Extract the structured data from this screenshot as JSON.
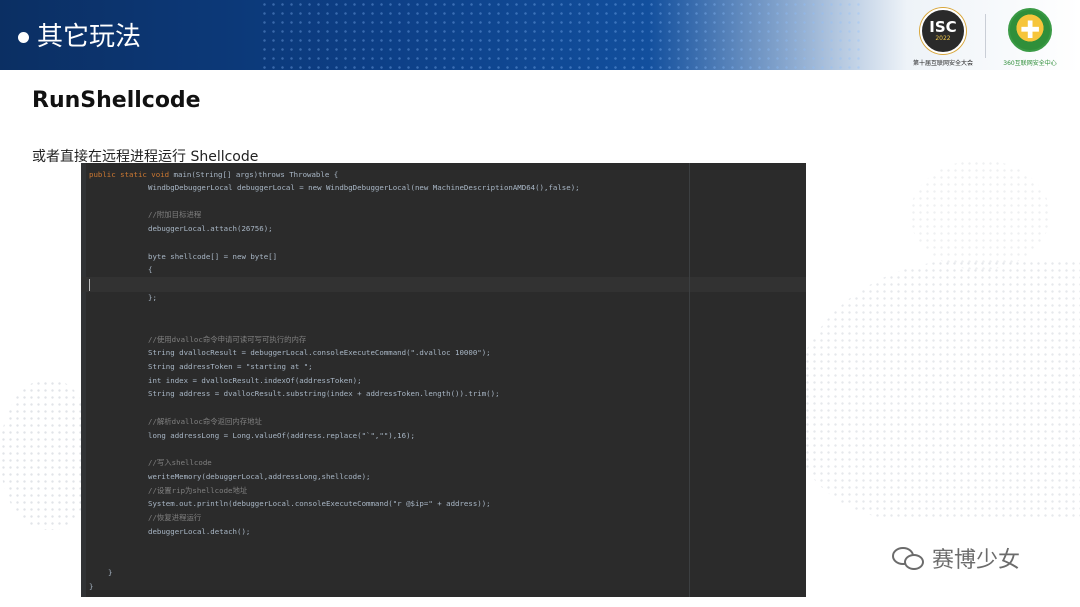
{
  "header": {
    "title": "其它玩法",
    "isc_logo_text": "ISC",
    "isc_logo_year": "2022",
    "isc_caption": "第十届互联网安全大会",
    "logo_360_symbol": "✚",
    "logo_360_caption": "360互联网安全中心"
  },
  "section_title": "RunShellcode",
  "description": "或者直接在远程进程运行 Shellcode",
  "code": {
    "l1": "public static void main(String[] args)throws Throwable {",
    "l2": "WindbgDebuggerLocal debuggerLocal = new WindbgDebuggerLocal(new MachineDescriptionAMD64(),false);",
    "l3": "//附加目标进程",
    "l4": "debuggerLocal.attach(26756);",
    "l5": "byte shellcode[] = new byte[]",
    "l6": "{",
    "l7": "};",
    "l8": "//使用dvalloc命令申请可读可写可执行的内存",
    "l9": "String dvallocResult = debuggerLocal.consoleExecuteCommand(\".dvalloc 10000\");",
    "l10": "String addressToken = \"starting at \";",
    "l11": "int index = dvallocResult.indexOf(addressToken);",
    "l12": "String address = dvallocResult.substring(index + addressToken.length()).trim();",
    "l13": "//解析dvalloc命令返回内存地址",
    "l14": "long addressLong = Long.valueOf(address.replace(\"`\",\"\"),16);",
    "l15": "//写入shellcode",
    "l16": "weriteMemory(debuggerLocal,addressLong,shellcode);",
    "l17": "//设置rip为shellcode地址",
    "l18": "System.out.println(debuggerLocal.consoleExecuteCommand(\"r @$ip=\" + address));",
    "l19": "//恢复进程运行",
    "l20": "debuggerLocal.detach();",
    "l21": "}",
    "l22": "}"
  },
  "watermark": "赛博少女"
}
